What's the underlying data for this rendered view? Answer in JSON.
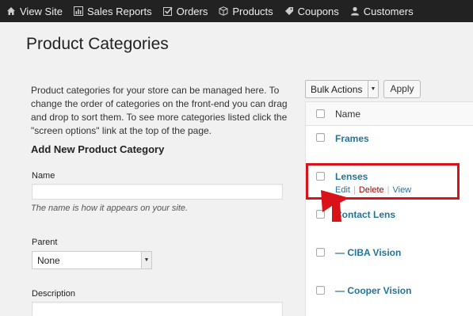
{
  "topbar": {
    "items": [
      {
        "label": "View Site",
        "icon": "home-icon"
      },
      {
        "label": "Sales Reports",
        "icon": "chart-icon"
      },
      {
        "label": "Orders",
        "icon": "checkbox-icon"
      },
      {
        "label": "Products",
        "icon": "box-icon"
      },
      {
        "label": "Coupons",
        "icon": "coupon-icon"
      },
      {
        "label": "Customers",
        "icon": "user-icon"
      }
    ]
  },
  "page": {
    "title": "Product Categories",
    "intro": "Product categories for your store can be managed here. To change the order of categories on the front-end you can drag and drop to sort them. To see more categories listed click the \"screen options\" link at the top of the page."
  },
  "form": {
    "heading": "Add New Product Category",
    "name_label": "Name",
    "name_value": "",
    "name_hint": "The name is how it appears on your site.",
    "parent_label": "Parent",
    "parent_value": "None",
    "description_label": "Description",
    "description_value": ""
  },
  "list": {
    "bulk_actions": "Bulk Actions",
    "apply": "Apply",
    "column_name": "Name",
    "rows": [
      {
        "name": "Frames"
      },
      {
        "name": "Lenses",
        "actions": {
          "edit": "Edit",
          "delete": "Delete",
          "view": "View"
        }
      },
      {
        "name": "Contact Lens"
      },
      {
        "name": "— CIBA Vision"
      },
      {
        "name": "— Cooper Vision"
      }
    ]
  },
  "annotation": {
    "color": "#d9121a"
  }
}
